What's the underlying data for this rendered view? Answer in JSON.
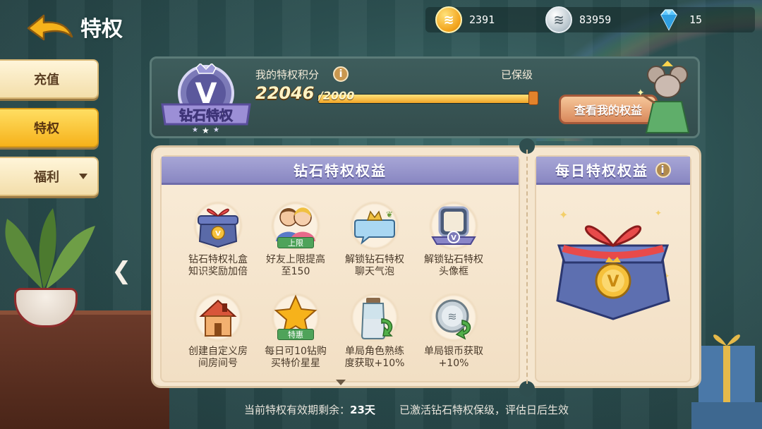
{
  "header": {
    "title": "特权"
  },
  "currencies": [
    {
      "icon": "gold-coin-icon",
      "value": "2391",
      "color": "#f2a21a"
    },
    {
      "icon": "silver-coin-icon",
      "value": "83959",
      "color": "#b7c4cc"
    },
    {
      "icon": "diamond-icon",
      "value": "15",
      "color": "#5ec8ff"
    }
  ],
  "menu": {
    "items": [
      {
        "label": "充值",
        "active": false
      },
      {
        "label": "特权",
        "active": true
      },
      {
        "label": "福利",
        "active": false
      }
    ]
  },
  "privilege": {
    "badge_text": "钻石特权",
    "score_label": "我的特权积分",
    "status": "已保级",
    "score": "22046",
    "score_max": "/2000",
    "progress": 1.0,
    "view_button": "查看我的权益"
  },
  "benefits": {
    "title": "钻石特权权益",
    "items": [
      {
        "icon": "gift-box-icon",
        "label": "钻石特权礼盒\n知识奖励加倍"
      },
      {
        "icon": "friends-icon",
        "label": "好友上限提高\n至150",
        "tag": "上限"
      },
      {
        "icon": "chat-bubble-icon",
        "label": "解锁钻石特权\n聊天气泡"
      },
      {
        "icon": "avatar-frame-icon",
        "label": "解锁钻石特权\n头像框"
      },
      {
        "icon": "house-icon",
        "label": "创建自定义房\n间房间号"
      },
      {
        "icon": "star-icon",
        "label": "每日可10钻购\n买特价星星",
        "tag": "特惠"
      },
      {
        "icon": "bottle-icon",
        "label": "单局角色熟练\n度获取+10%"
      },
      {
        "icon": "silver-coin-cycle-icon",
        "label": "单局银币获取\n+10%"
      }
    ]
  },
  "daily": {
    "title": "每日特权权益"
  },
  "footer": {
    "remaining_label": "当前特权有效期剩余：",
    "remaining_value": "23天",
    "note": "已激活钻石特权保级，评估日后生效"
  }
}
